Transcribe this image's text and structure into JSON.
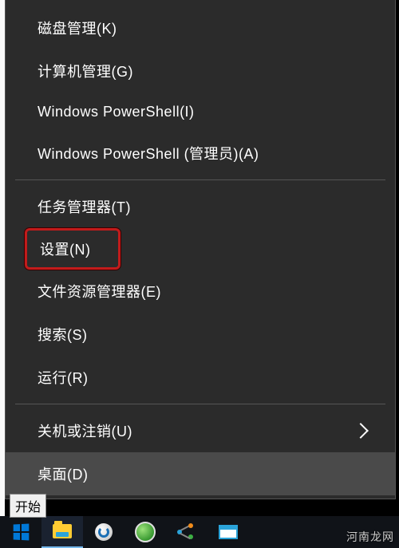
{
  "menu": {
    "items": [
      {
        "label": "磁盘管理(K)"
      },
      {
        "label": "计算机管理(G)"
      },
      {
        "label": "Windows PowerShell(I)"
      },
      {
        "label": "Windows PowerShell (管理员)(A)"
      }
    ],
    "items2": [
      {
        "label": "任务管理器(T)"
      },
      {
        "label": "设置(N)"
      },
      {
        "label": "文件资源管理器(E)"
      },
      {
        "label": "搜索(S)"
      },
      {
        "label": "运行(R)"
      }
    ],
    "items3": [
      {
        "label": "关机或注销(U)",
        "submenu": true
      },
      {
        "label": "桌面(D)"
      }
    ]
  },
  "tooltip": "开始",
  "watermark": "河南龙网"
}
